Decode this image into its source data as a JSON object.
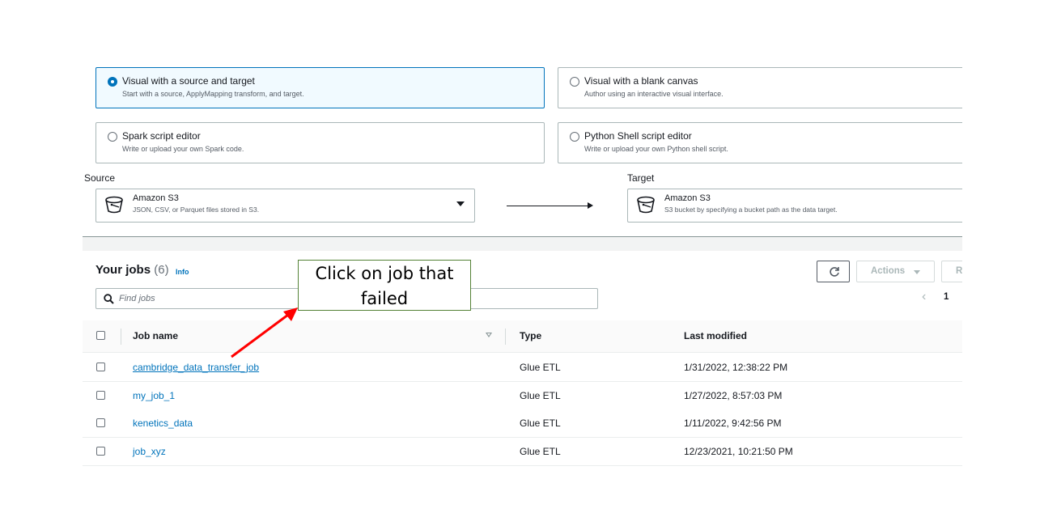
{
  "options": [
    {
      "title": "Visual with a source and target",
      "desc": "Start with a source, ApplyMapping transform, and target.",
      "selected": true
    },
    {
      "title": "Visual with a blank canvas",
      "desc": "Author using an interactive visual interface.",
      "selected": false
    },
    {
      "title": "Spark script editor",
      "desc": "Write or upload your own Spark code.",
      "selected": false
    },
    {
      "title": "Python Shell script editor",
      "desc": "Write or upload your own Python shell script.",
      "selected": false
    }
  ],
  "source": {
    "label": "Source",
    "title": "Amazon S3",
    "desc": "JSON, CSV, or Parquet files stored in S3.",
    "icon": "bucket-icon"
  },
  "target": {
    "label": "Target",
    "title": "Amazon S3",
    "desc": "S3 bucket by specifying a bucket path as the data target.",
    "icon": "bucket-icon"
  },
  "jobs": {
    "title": "Your jobs",
    "count": "(6)",
    "info": "Info",
    "refresh_icon": "refresh-icon",
    "actions_label": "Actions",
    "cut_button_label": "R",
    "search_placeholder": "Find jobs",
    "pager_page": "1",
    "columns": {
      "name": "Job name",
      "type": "Type",
      "modified": "Last modified"
    },
    "rows": [
      {
        "name": "cambridge_data_transfer_job",
        "type": "Glue ETL",
        "modified": "1/31/2022, 12:38:22 PM"
      },
      {
        "name": "my_job_1",
        "type": "Glue ETL",
        "modified": "1/27/2022, 8:57:03 PM"
      },
      {
        "name": "kenetics_data",
        "type": "Glue ETL",
        "modified": "1/11/2022, 9:42:56 PM"
      },
      {
        "name": "job_xyz",
        "type": "Glue ETL",
        "modified": "12/23/2021, 10:21:50 PM"
      }
    ]
  },
  "annotation": {
    "line1": "Click on job that",
    "line2": "failed"
  },
  "colors": {
    "accent": "#0073bb",
    "callout_border": "#548235",
    "annotation_arrow": "#ff0000"
  }
}
